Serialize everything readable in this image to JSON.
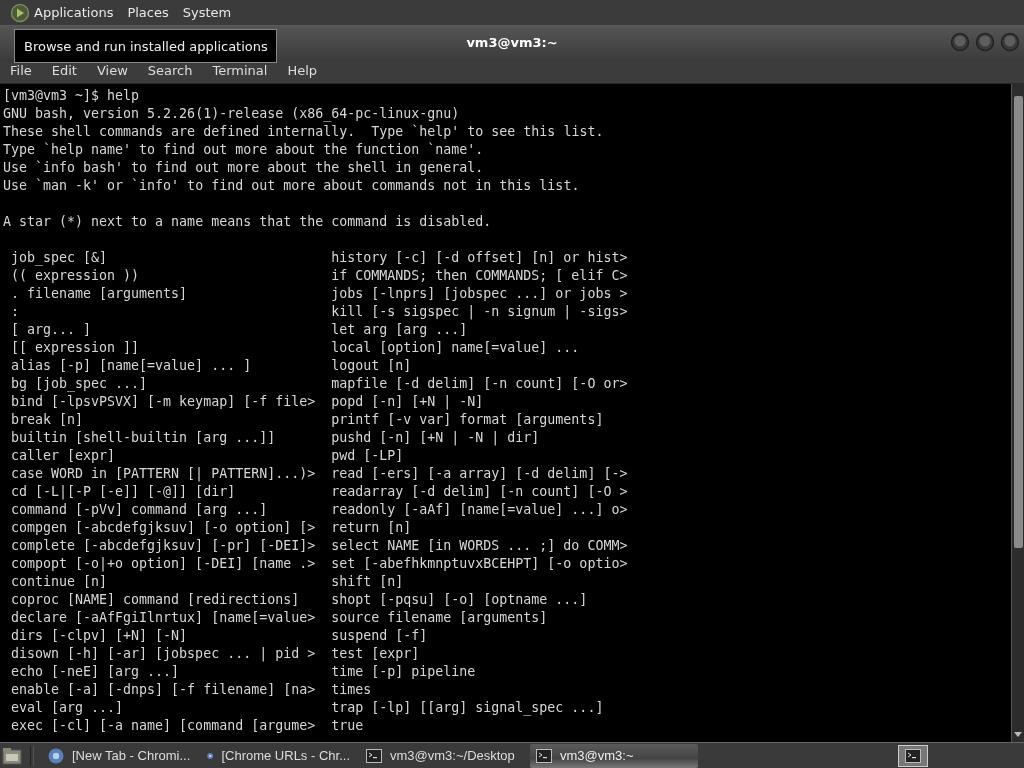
{
  "top_panel": {
    "menus": [
      {
        "label": "Applications"
      },
      {
        "label": "Places"
      },
      {
        "label": "System"
      }
    ]
  },
  "tooltip": {
    "text": "Browse and run installed applications"
  },
  "window": {
    "title": "vm3@vm3:~",
    "menu": [
      "File",
      "Edit",
      "View",
      "Search",
      "Terminal",
      "Help"
    ]
  },
  "terminal": {
    "intro": [
      "[vm3@vm3 ~]$ help",
      "GNU bash, version 5.2.26(1)-release (x86_64-pc-linux-gnu)",
      "These shell commands are defined internally.  Type `help' to see this list.",
      "Type `help name' to find out more about the function `name'.",
      "Use `info bash' to find out more about the shell in general.",
      "Use `man -k' or `info' to find out more about commands not in this list."
    ],
    "note": "A star (*) next to a name means that the command is disabled.",
    "commands": [
      {
        "left": "job_spec [&]",
        "right": "history [-c] [-d offset] [n] or hist>"
      },
      {
        "left": "(( expression ))",
        "right": "if COMMANDS; then COMMANDS; [ elif C>"
      },
      {
        "left": ". filename [arguments]",
        "right": "jobs [-lnprs] [jobspec ...] or jobs >"
      },
      {
        "left": ":",
        "right": "kill [-s sigspec | -n signum | -sigs>"
      },
      {
        "left": "[ arg... ]",
        "right": "let arg [arg ...]"
      },
      {
        "left": "[[ expression ]]",
        "right": "local [option] name[=value] ..."
      },
      {
        "left": "alias [-p] [name[=value] ... ]",
        "right": "logout [n]"
      },
      {
        "left": "bg [job_spec ...]",
        "right": "mapfile [-d delim] [-n count] [-O or>"
      },
      {
        "left": "bind [-lpsvPSVX] [-m keymap] [-f file>",
        "right": "popd [-n] [+N | -N]"
      },
      {
        "left": "break [n]",
        "right": "printf [-v var] format [arguments]"
      },
      {
        "left": "builtin [shell-builtin [arg ...]]",
        "right": "pushd [-n] [+N | -N | dir]"
      },
      {
        "left": "caller [expr]",
        "right": "pwd [-LP]"
      },
      {
        "left": "case WORD in [PATTERN [| PATTERN]...)>",
        "right": "read [-ers] [-a array] [-d delim] [->"
      },
      {
        "left": "cd [-L|[-P [-e]] [-@]] [dir]",
        "right": "readarray [-d delim] [-n count] [-O >"
      },
      {
        "left": "command [-pVv] command [arg ...]",
        "right": "readonly [-aAf] [name[=value] ...] o>"
      },
      {
        "left": "compgen [-abcdefgjksuv] [-o option] [>",
        "right": "return [n]"
      },
      {
        "left": "complete [-abcdefgjksuv] [-pr] [-DEI]>",
        "right": "select NAME [in WORDS ... ;] do COMM>"
      },
      {
        "left": "compopt [-o|+o option] [-DEI] [name .>",
        "right": "set [-abefhkmnptuvxBCEHPT] [-o optio>"
      },
      {
        "left": "continue [n]",
        "right": "shift [n]"
      },
      {
        "left": "coproc [NAME] command [redirections]",
        "right": "shopt [-pqsu] [-o] [optname ...]"
      },
      {
        "left": "declare [-aAfFgiIlnrtux] [name[=value>",
        "right": "source filename [arguments]"
      },
      {
        "left": "dirs [-clpv] [+N] [-N]",
        "right": "suspend [-f]"
      },
      {
        "left": "disown [-h] [-ar] [jobspec ... | pid >",
        "right": "test [expr]"
      },
      {
        "left": "echo [-neE] [arg ...]",
        "right": "time [-p] pipeline"
      },
      {
        "left": "enable [-a] [-dnps] [-f filename] [na>",
        "right": "times"
      },
      {
        "left": "eval [arg ...]",
        "right": "trap [-lp] [[arg] signal_spec ...]"
      },
      {
        "left": "exec [-cl] [-a name] [command [argume>",
        "right": "true"
      }
    ]
  },
  "taskbar": {
    "tasks": [
      {
        "kind": "browser",
        "label": "[New Tab - Chromi...",
        "selected": false
      },
      {
        "kind": "browser",
        "label": "[Chrome URLs - Chr...",
        "selected": false
      },
      {
        "kind": "terminal",
        "label": "vm3@vm3:~/Desktop",
        "selected": false
      },
      {
        "kind": "terminal",
        "label": "vm3@vm3:~",
        "selected": true
      }
    ]
  }
}
